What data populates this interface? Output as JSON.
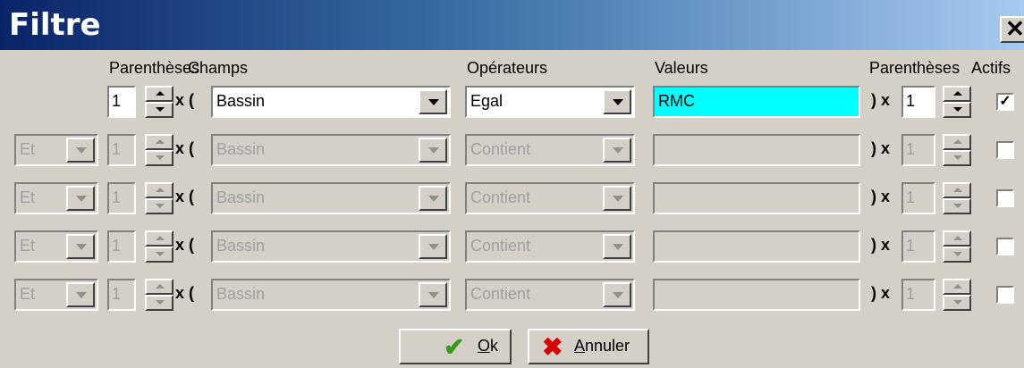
{
  "window": {
    "title": "Filtre",
    "close_glyph": "✕"
  },
  "headers": {
    "parentheses_left": "Parenthèses",
    "champs": "Champs",
    "operateurs": "Opérateurs",
    "valeurs": "Valeurs",
    "parentheses_right": "Parenthèses",
    "actifs": "Actifs"
  },
  "glyphs": {
    "open_paren_label": "x (",
    "close_paren_label": ") x"
  },
  "rows": [
    {
      "enabled": true,
      "logic": "",
      "open_count": "1",
      "field": "Bassin",
      "operator": "Egal",
      "value": "RMC",
      "close_count": "1",
      "active": true
    },
    {
      "enabled": false,
      "logic": "Et",
      "open_count": "1",
      "field": "Bassin",
      "operator": "Contient",
      "value": "",
      "close_count": "1",
      "active": false
    },
    {
      "enabled": false,
      "logic": "Et",
      "open_count": "1",
      "field": "Bassin",
      "operator": "Contient",
      "value": "",
      "close_count": "1",
      "active": false
    },
    {
      "enabled": false,
      "logic": "Et",
      "open_count": "1",
      "field": "Bassin",
      "operator": "Contient",
      "value": "",
      "close_count": "1",
      "active": false
    },
    {
      "enabled": false,
      "logic": "Et",
      "open_count": "1",
      "field": "Bassin",
      "operator": "Contient",
      "value": "",
      "close_count": "1",
      "active": false
    }
  ],
  "buttons": {
    "ok": {
      "label_underlined": "O",
      "label_rest": "k",
      "icon": "check-icon"
    },
    "cancel": {
      "label_underlined": "A",
      "label_rest": "nnuler",
      "icon": "x-icon"
    }
  },
  "colors": {
    "value_highlight": "#00ffff",
    "titlebar_start": "#0a246a",
    "ok_green": "#3a9a1a",
    "cancel_red": "#d40000"
  }
}
